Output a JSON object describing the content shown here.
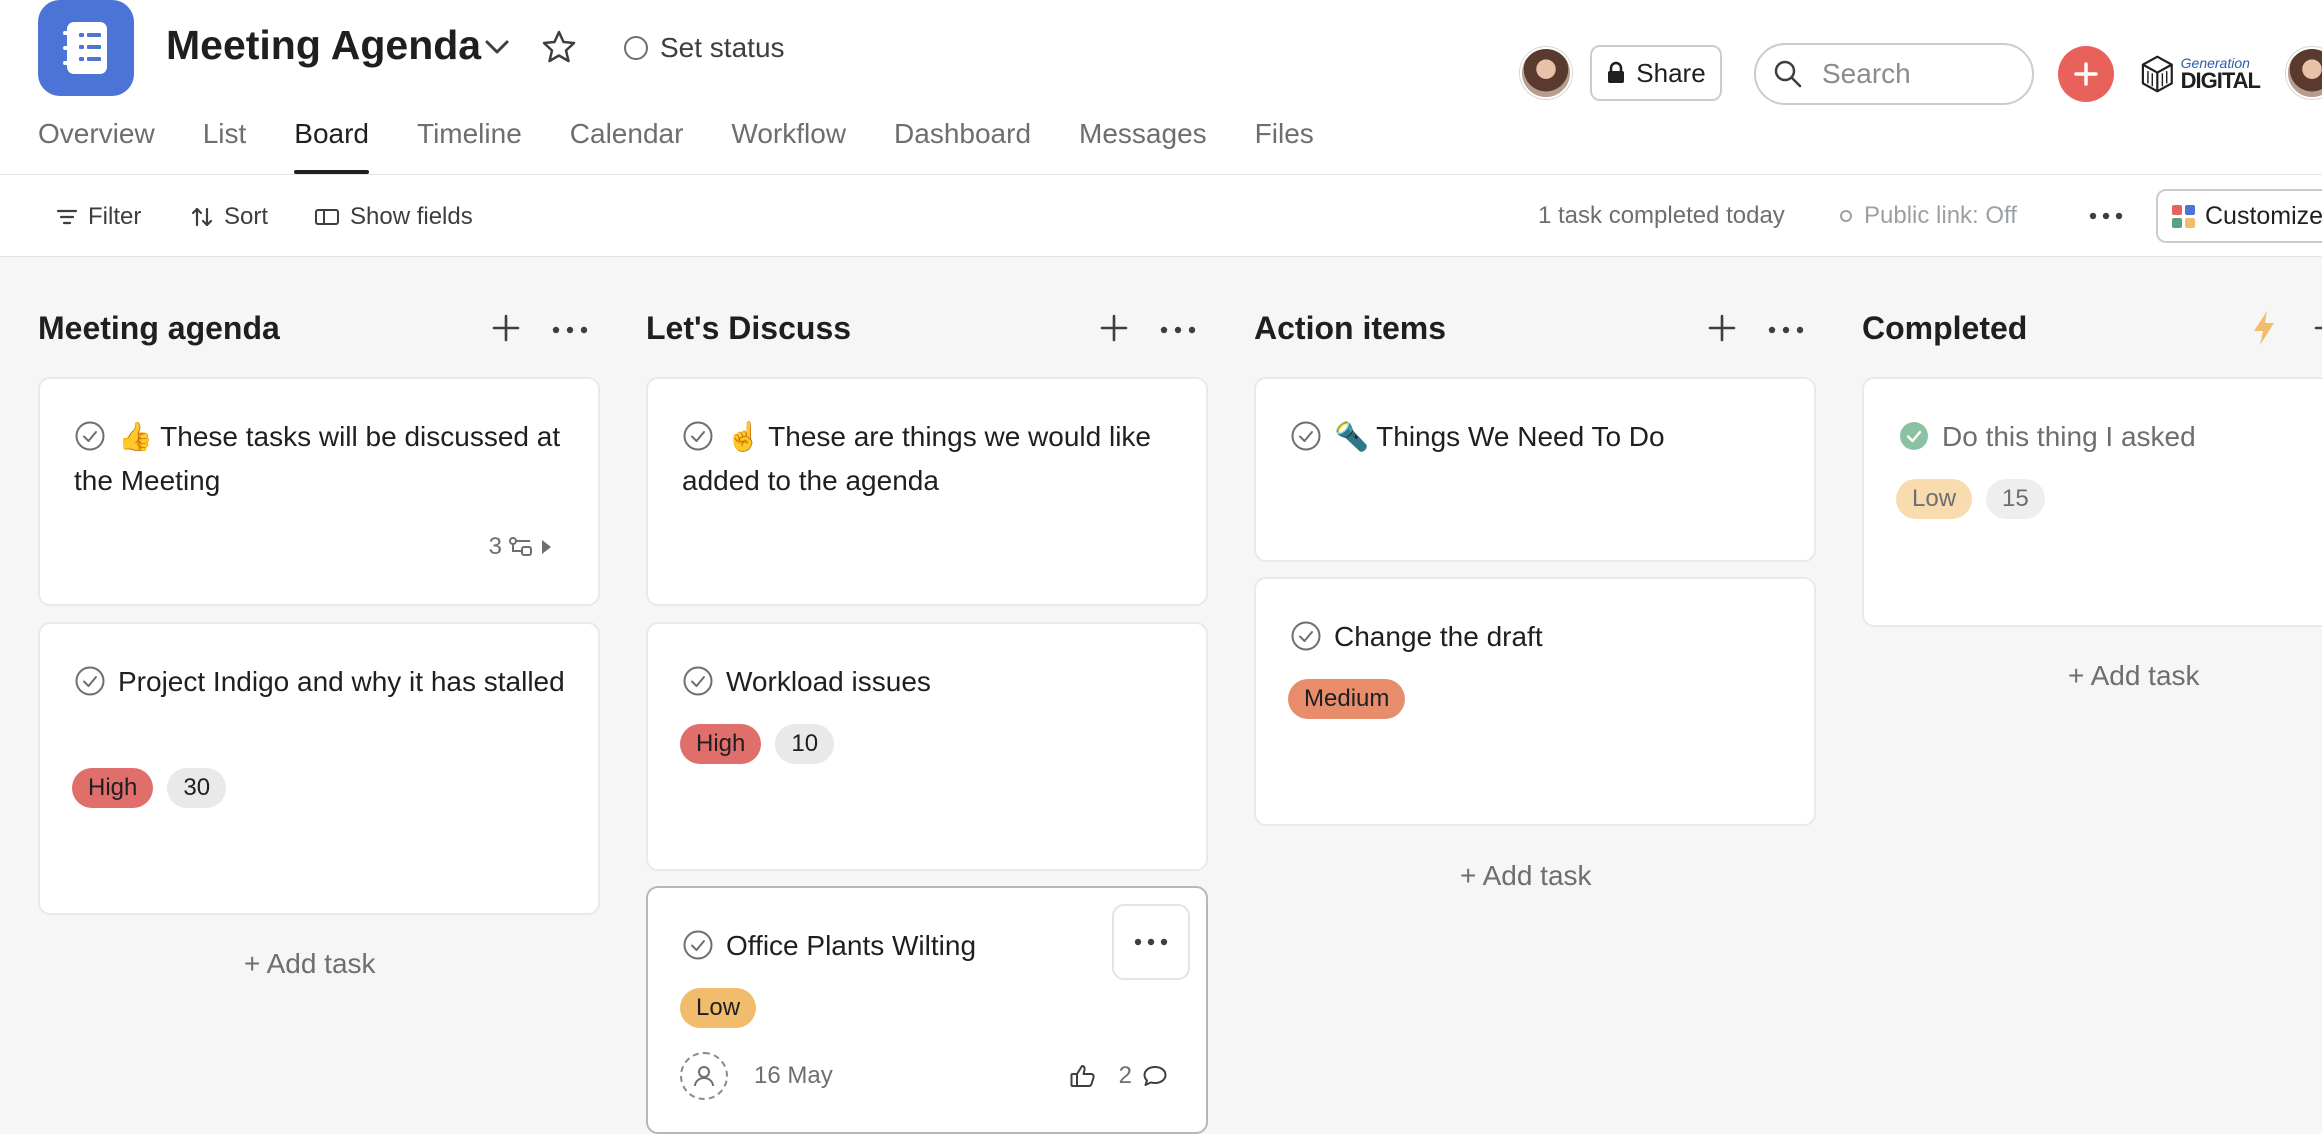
{
  "project": {
    "title": "Meeting Agenda",
    "set_status_label": "Set status"
  },
  "header": {
    "share_label": "Share",
    "search_placeholder": "Search",
    "brand_line1": "Generation",
    "brand_line2": "DIGITAL"
  },
  "tabs": [
    {
      "label": "Overview",
      "active": false
    },
    {
      "label": "List",
      "active": false
    },
    {
      "label": "Board",
      "active": true
    },
    {
      "label": "Timeline",
      "active": false
    },
    {
      "label": "Calendar",
      "active": false
    },
    {
      "label": "Workflow",
      "active": false
    },
    {
      "label": "Dashboard",
      "active": false
    },
    {
      "label": "Messages",
      "active": false
    },
    {
      "label": "Files",
      "active": false
    }
  ],
  "toolbar": {
    "filter_label": "Filter",
    "sort_label": "Sort",
    "show_fields_label": "Show fields",
    "completed_today": "1 task completed today",
    "public_link": "Public link: Off",
    "customize_label": "Customize"
  },
  "colors": {
    "accent": "#4c73d6",
    "add_button": "#e8615b",
    "priority_high": "#e06e6a",
    "priority_medium": "#e88d6c",
    "priority_low": "#f1bd6c",
    "completed_check": "#58a182"
  },
  "columns": [
    {
      "title": "Meeting agenda",
      "add_task_label": "+ Add task",
      "cards": [
        {
          "title": "👍 These tasks will be discussed at the Meeting",
          "subtasks": "3"
        },
        {
          "title": "Project Indigo and why it has stalled",
          "priority": "High",
          "points": "30"
        }
      ]
    },
    {
      "title": "Let's Discuss",
      "cards": [
        {
          "title": "☝️ These are things we would like added to the agenda"
        },
        {
          "title": "Workload issues",
          "priority": "High",
          "points": "10"
        },
        {
          "title": "Office Plants Wilting",
          "priority": "Low",
          "due": "16 May",
          "likes": "",
          "comments": "2"
        }
      ]
    },
    {
      "title": "Action items",
      "add_task_label": "+ Add task",
      "cards": [
        {
          "title": "🔦 Things We Need To Do"
        },
        {
          "title": "Change the draft",
          "priority": "Medium"
        }
      ]
    },
    {
      "title": "Completed",
      "add_task_label": "+ Add task",
      "cards": [
        {
          "title": "Do this thing I asked",
          "priority": "Low",
          "points": "15",
          "completed": true
        }
      ]
    }
  ]
}
